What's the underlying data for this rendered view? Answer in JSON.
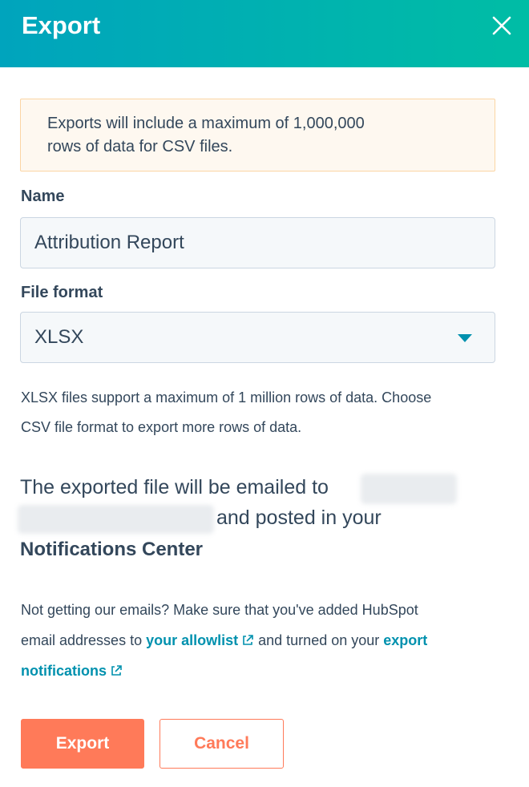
{
  "dialog": {
    "title": "Export",
    "close_icon": "close-icon"
  },
  "alert": {
    "line1": "Exports will include a maximum of 1,000,000",
    "line2": "rows of data for CSV files."
  },
  "name_field": {
    "label": "Name",
    "value": "Attribution Report"
  },
  "format_field": {
    "label": "File format",
    "value": "XLSX",
    "caret_icon": "caret-down-icon"
  },
  "format_help": {
    "line1": "XLSX files support a maximum of 1 million rows of data. Choose",
    "line2": "CSV file format to export more rows of data."
  },
  "delivery": {
    "text_before": "The exported file will be emailed to",
    "text_after": "and posted in your",
    "location": "Notifications Center"
  },
  "tips": {
    "line1": "Not getting our emails? Make sure that you've added HubSpot",
    "line2_prefix": "email addresses to",
    "allowlist_link": "your allowlist",
    "line2_middle": "and turned on your",
    "export_link_part1": "export",
    "export_link_part2": "notifications",
    "external_icon": "external-link-icon"
  },
  "actions": {
    "export_label": "Export",
    "cancel_label": "Cancel"
  },
  "colors": {
    "header_gradient_start": "#00a4bd",
    "header_gradient_end": "#00bda5",
    "primary_button": "#ff7a59",
    "link": "#0091ae",
    "text": "#33475b",
    "alert_bg": "#fef8f0",
    "alert_border": "#fbd5a4"
  }
}
